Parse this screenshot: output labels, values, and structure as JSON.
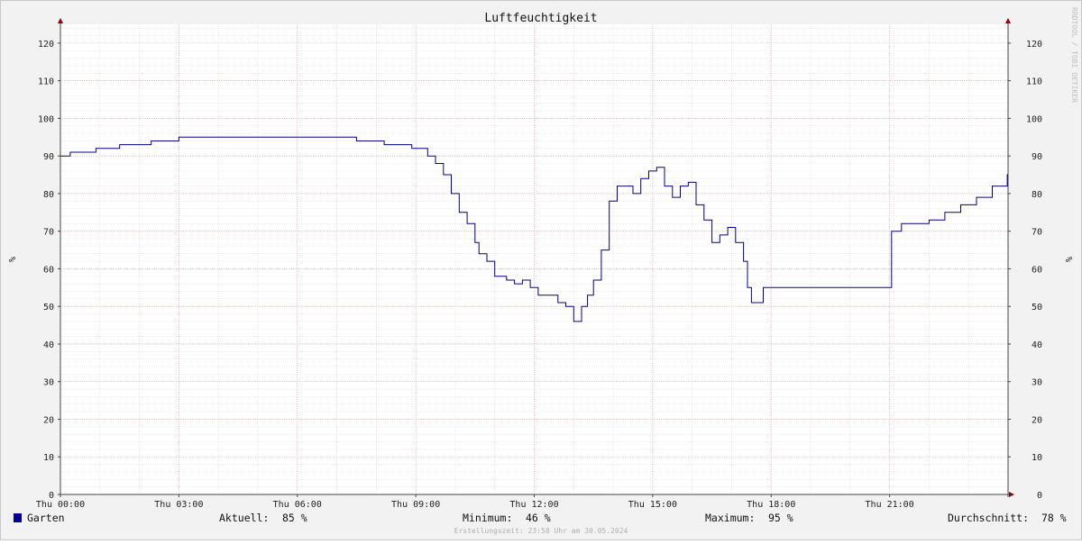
{
  "title": "Luftfeuchtigkeit",
  "side_label": "RRDTOOL / TOBI OETIKER",
  "footer": "Erstellungszeit: 23:58 Uhr am 30.05.2024",
  "legend": {
    "series_name": "Garten",
    "current_label": "Aktuell:",
    "current_value": "85 %",
    "min_label": "Minimum:",
    "min_value": "46 %",
    "max_label": "Maximum:",
    "max_value": "95 %",
    "avg_label": "Durchschnitt:",
    "avg_value": "78 %"
  },
  "colors": {
    "line": "#00008b",
    "swatch": "#0000a0",
    "major_grid": "#f0a0a0",
    "minor_grid": "#dddddd",
    "axis": "#8b0000"
  },
  "chart_data": {
    "type": "line",
    "title": "Luftfeuchtigkeit",
    "ylabel": "%",
    "ylim": [
      0,
      125
    ],
    "xlim_hours": [
      0,
      24
    ],
    "y_ticks": [
      0,
      10,
      20,
      30,
      40,
      50,
      60,
      70,
      80,
      90,
      100,
      110,
      120
    ],
    "x_tick_labels": [
      "Thu 00:00",
      "Thu 03:00",
      "Thu 06:00",
      "Thu 09:00",
      "Thu 12:00",
      "Thu 15:00",
      "Thu 18:00",
      "Thu 21:00"
    ],
    "x_tick_hours": [
      0,
      3,
      6,
      9,
      12,
      15,
      18,
      21
    ],
    "grid": true,
    "series": [
      {
        "name": "Garten",
        "x_hours": [
          0,
          0.25,
          0.9,
          1.5,
          2.3,
          3.0,
          4.0,
          4.5,
          5.5,
          6.5,
          7.5,
          8.2,
          8.9,
          9.3,
          9.5,
          9.7,
          9.9,
          10.1,
          10.3,
          10.5,
          10.6,
          10.8,
          11.0,
          11.3,
          11.5,
          11.7,
          11.9,
          12.1,
          12.3,
          12.6,
          12.8,
          13.0,
          13.2,
          13.35,
          13.5,
          13.7,
          13.9,
          14.1,
          14.3,
          14.5,
          14.7,
          14.9,
          15.1,
          15.3,
          15.5,
          15.7,
          15.9,
          16.1,
          16.3,
          16.5,
          16.7,
          16.9,
          17.1,
          17.3,
          17.4,
          17.5,
          17.8,
          19.0,
          20.0,
          21.0,
          21.05,
          21.3,
          21.6,
          22.0,
          22.4,
          22.8,
          23.2,
          23.6,
          23.98
        ],
        "values": [
          90,
          91,
          92,
          93,
          94,
          95,
          95,
          95,
          95,
          95,
          94,
          93,
          92,
          90,
          88,
          85,
          80,
          75,
          72,
          67,
          64,
          62,
          58,
          57,
          56,
          57,
          55,
          53,
          53,
          51,
          50,
          46,
          50,
          53,
          57,
          65,
          78,
          82,
          82,
          80,
          84,
          86,
          87,
          82,
          79,
          82,
          83,
          77,
          73,
          67,
          69,
          71,
          67,
          62,
          55,
          51,
          55,
          55,
          55,
          55,
          70,
          72,
          72,
          73,
          75,
          77,
          79,
          82,
          85
        ]
      }
    ]
  }
}
